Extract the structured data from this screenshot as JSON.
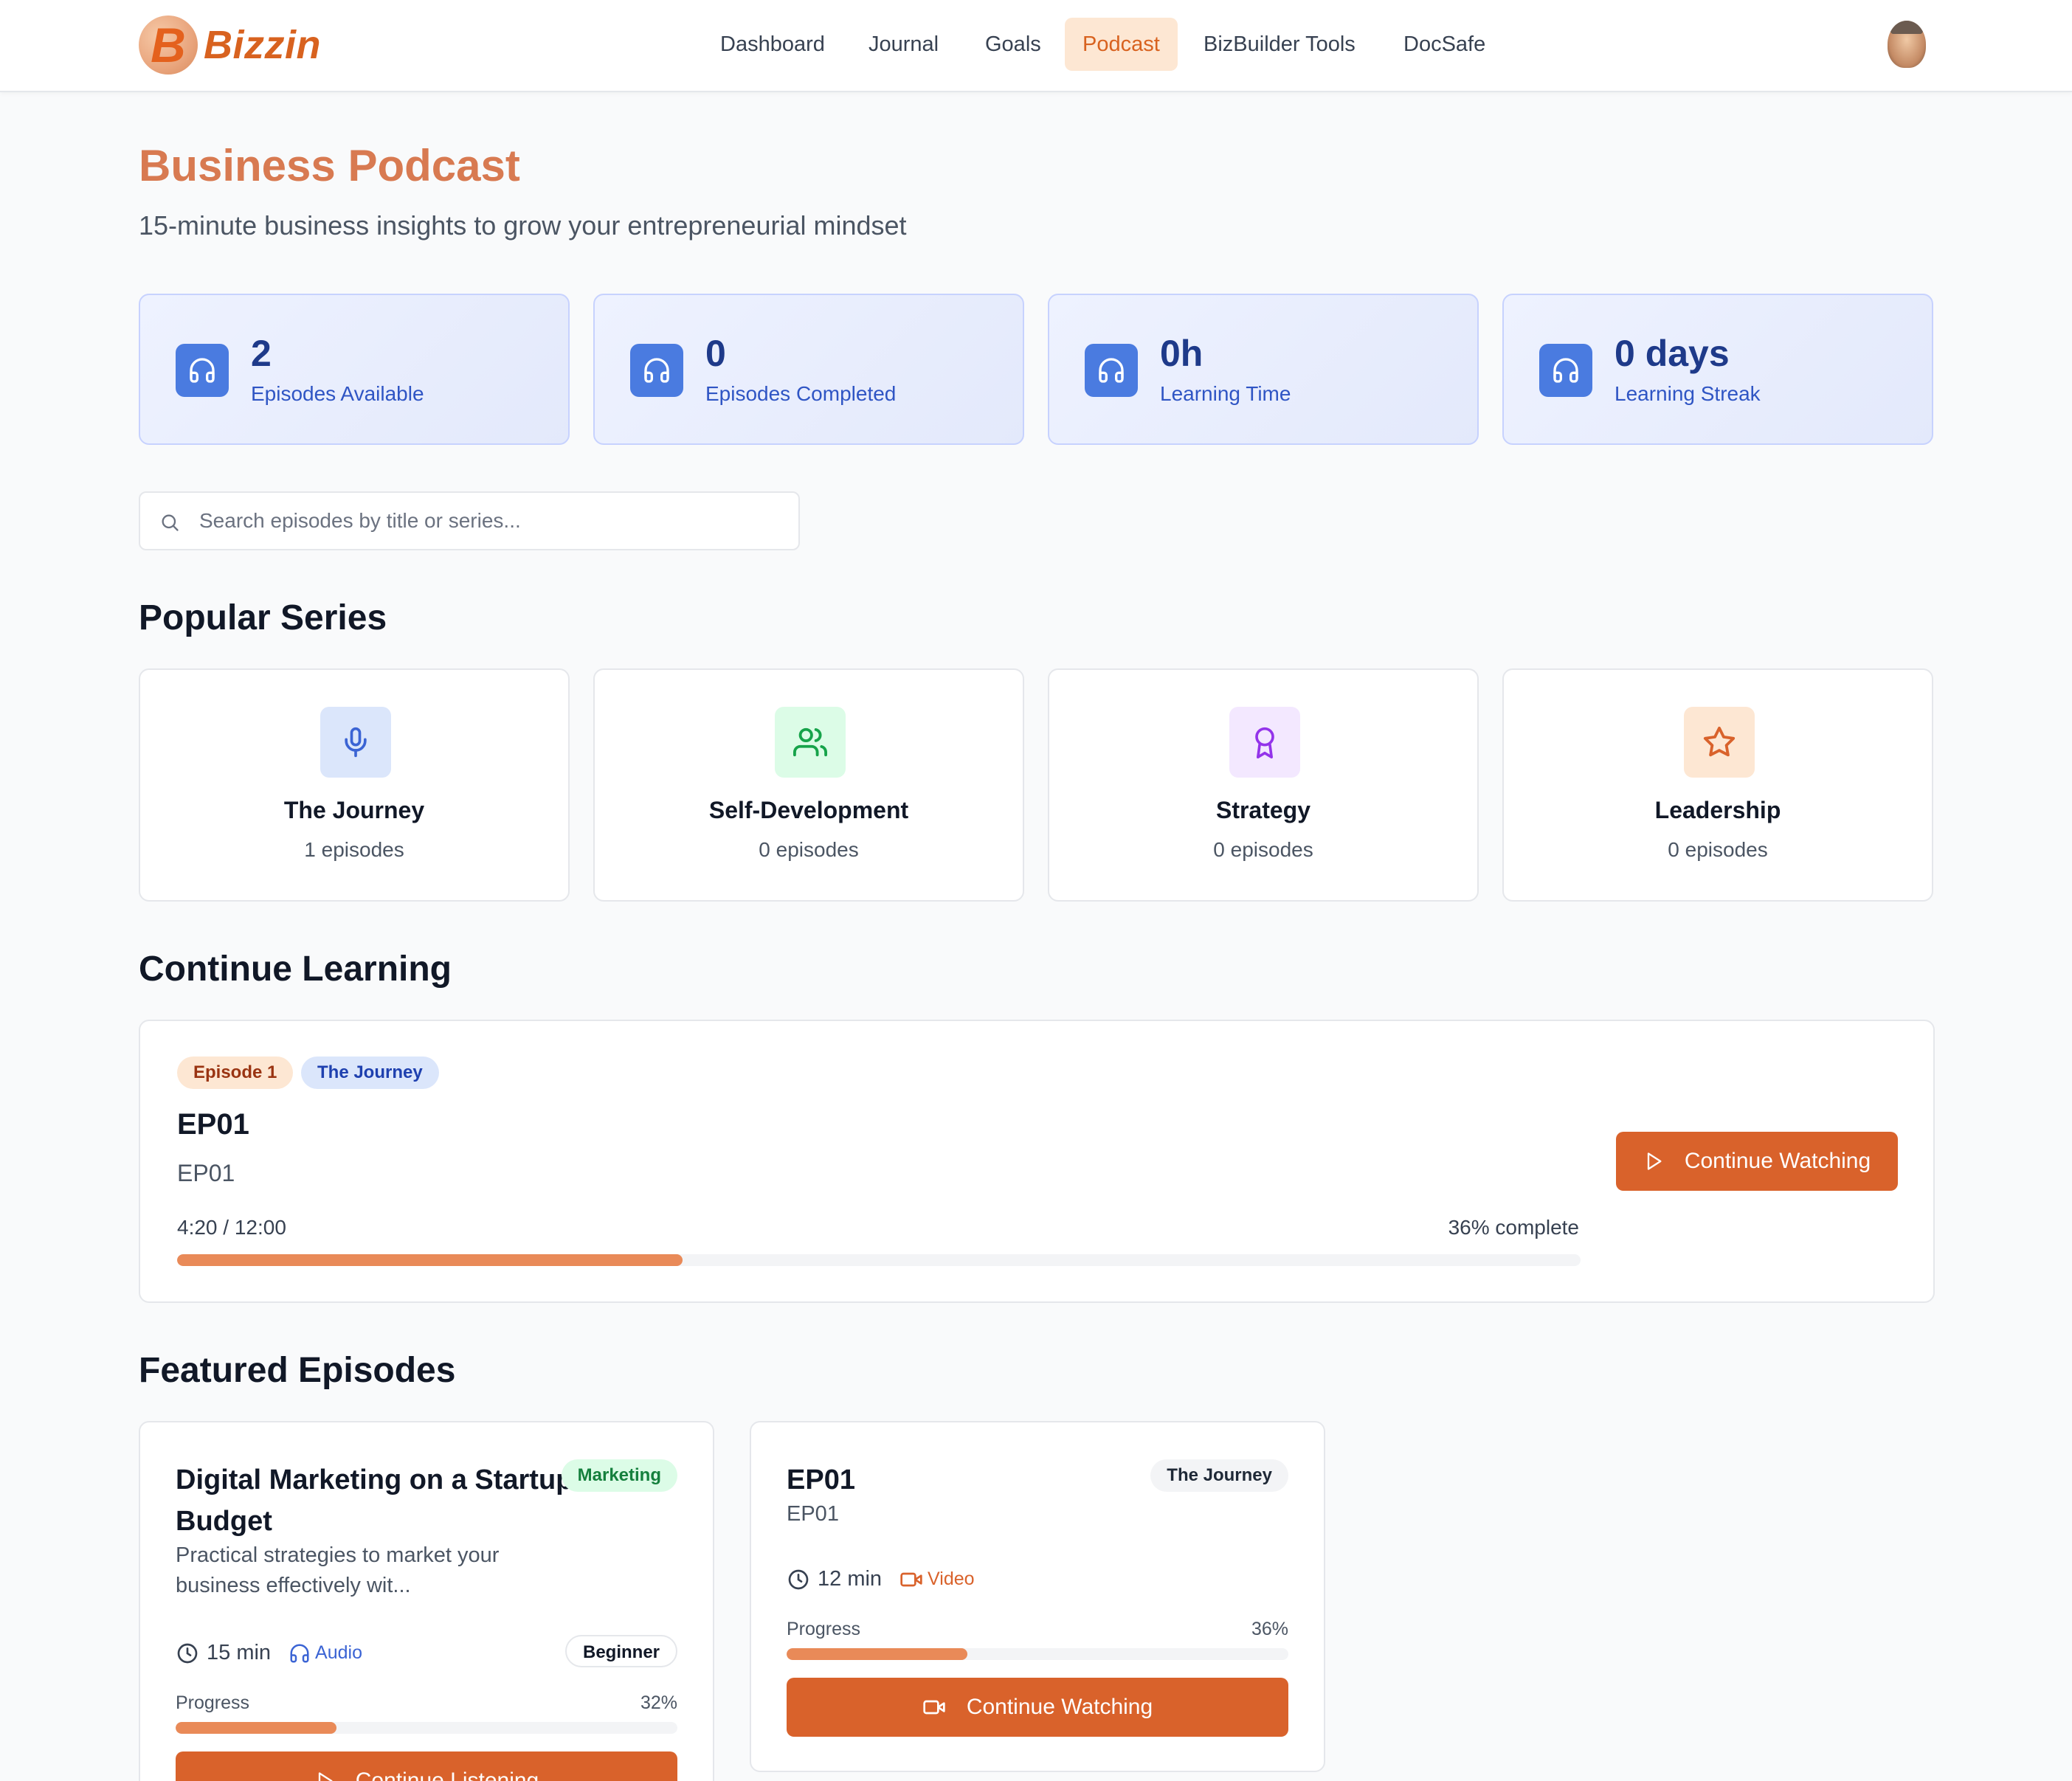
{
  "brand": {
    "name": "Bizzin",
    "mark": "B"
  },
  "nav": {
    "items": [
      {
        "label": "Dashboard",
        "active": false
      },
      {
        "label": "Journal",
        "active": false
      },
      {
        "label": "Goals",
        "active": false
      },
      {
        "label": "Podcast",
        "active": true
      },
      {
        "label": "BizBuilder Tools",
        "active": false
      },
      {
        "label": "DocSafe",
        "active": false
      }
    ]
  },
  "page": {
    "title": "Business Podcast",
    "subtitle": "15-minute business insights to grow your entrepreneurial mindset"
  },
  "stats": [
    {
      "value": "2",
      "label": "Episodes Available",
      "icon": "headphones-icon"
    },
    {
      "value": "0",
      "label": "Episodes Completed",
      "icon": "headphones-icon"
    },
    {
      "value": "0h",
      "label": "Learning Time",
      "icon": "headphones-icon"
    },
    {
      "value": "0 days",
      "label": "Learning Streak",
      "icon": "headphones-icon"
    }
  ],
  "search": {
    "placeholder": "Search episodes by title or series...",
    "value": ""
  },
  "sections": {
    "popular_series": "Popular Series",
    "continue_learning": "Continue Learning",
    "featured_episodes": "Featured Episodes"
  },
  "series": [
    {
      "name": "The Journey",
      "count": "1 episodes",
      "icon": "microphone-icon",
      "bg": "#dbe6fb",
      "color": "#3b64d4"
    },
    {
      "name": "Self-Development",
      "count": "0 episodes",
      "icon": "users-icon",
      "bg": "#dcfce7",
      "color": "#16a34a"
    },
    {
      "name": "Strategy",
      "count": "0 episodes",
      "icon": "award-icon",
      "bg": "#f3e8ff",
      "color": "#9333ea"
    },
    {
      "name": "Leadership",
      "count": "0 episodes",
      "icon": "star-icon",
      "bg": "#fde7d3",
      "color": "#d9622b"
    }
  ],
  "continue": {
    "episode_badge": "Episode 1",
    "series_badge": "The Journey",
    "title": "EP01",
    "subtitle": "EP01",
    "time": "4:20 / 12:00",
    "percent_label": "36% complete",
    "progress": 0.36,
    "button": "Continue Watching"
  },
  "featured": [
    {
      "title_line1": "Digital Marketing on a Startup",
      "title_line2": "Budget",
      "tag": "Marketing",
      "desc_line1": "Practical strategies to market your",
      "desc_line2": "business effectively wit...",
      "duration": "15 min",
      "type": "Audio",
      "level": "Beginner",
      "progress_label": "Progress",
      "progress_pct": "32%",
      "progress": 0.32,
      "button": "Continue Listening"
    },
    {
      "title": "EP01",
      "subtitle": "EP01",
      "tag": "The Journey",
      "duration": "12 min",
      "type": "Video",
      "progress_label": "Progress",
      "progress_pct": "36%",
      "progress": 0.36,
      "button": "Continue Watching"
    }
  ],
  "colors": {
    "accent": "#d9622b",
    "progress": "#e98a58",
    "stat_icon": "#4a7be0",
    "title": "#d87a51"
  }
}
